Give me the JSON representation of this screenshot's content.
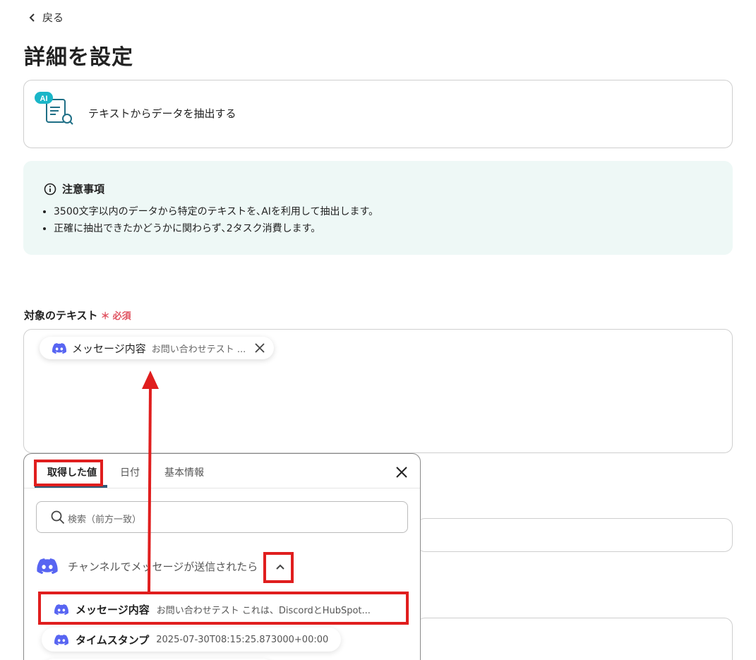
{
  "nav": {
    "back_label": "戻る"
  },
  "page": {
    "title": "詳細を設定"
  },
  "operation": {
    "badge": "AI",
    "label": "テキストからデータを抽出する"
  },
  "notice": {
    "title": "注意事項",
    "items": [
      "3500文字以内のデータから特定のテキストを､AIを利用して抽出します。",
      "正確に抽出できたかどうかに関わらず､2タスク消費します。"
    ]
  },
  "field": {
    "label": "対象のテキスト",
    "required_mark": "＊",
    "required_label": "必須",
    "chip": {
      "title": "メッセージ内容",
      "value": "お問い合わせテスト ..."
    }
  },
  "picker": {
    "tabs": [
      "取得した値",
      "日付",
      "基本情報"
    ],
    "search_placeholder": "検索（前方一致）",
    "trigger_label": "チャンネルでメッセージが送信されたら",
    "items": [
      {
        "title": "メッセージ内容",
        "value": "お問い合わせテスト これは、DiscordとHubSpot..."
      },
      {
        "title": "タイムスタンプ",
        "value": "2025-07-30T08:15:25.873000+00:00"
      }
    ]
  },
  "colors": {
    "accent": "#1ab6c8",
    "discord": "#5865f2",
    "highlight": "#e01e1e",
    "notice_bg": "#eef8f6",
    "required": "#e05260"
  }
}
